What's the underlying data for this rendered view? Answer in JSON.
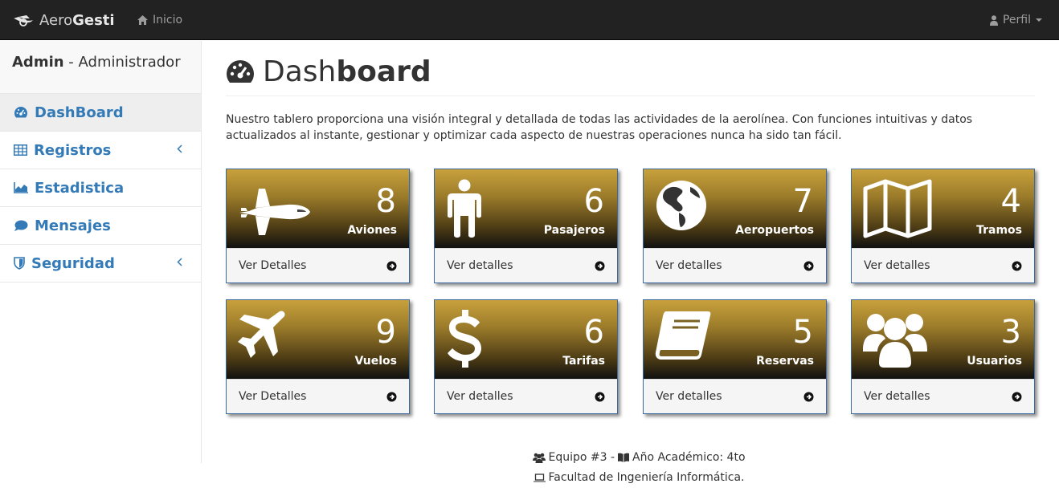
{
  "navbar": {
    "brand_prefix": "Aero",
    "brand_suffix": "Gesti",
    "home_label": "Inicio",
    "profile_label": "Perfil"
  },
  "sidebar": {
    "user_role_name": "Admin",
    "user_separator": " - ",
    "user_role_title": "Administrador",
    "items": [
      {
        "label": "DashBoard",
        "icon": "dashboard-icon",
        "active": true
      },
      {
        "label": "Registros",
        "icon": "table-icon",
        "has_submenu": true
      },
      {
        "label": "Estadistica",
        "icon": "area-chart-icon"
      },
      {
        "label": "Mensajes",
        "icon": "comment-icon"
      },
      {
        "label": "Seguridad",
        "icon": "shield-icon",
        "has_submenu": true
      }
    ]
  },
  "page": {
    "title_light": "Dash",
    "title_bold": "board",
    "intro_line1": "Nuestro tablero proporciona una visión integral y detallada de todas las actividades de la aerolínea. Con funciones intuitivas y datos",
    "intro_line2": "actualizados al instante, gestionar y optimizar cada aspecto de nuestras operaciones nunca ha sido tan fácil."
  },
  "cards": [
    {
      "count": "8",
      "label": "Aviones",
      "link": "Ver Detalles",
      "icon": "space-shuttle-icon"
    },
    {
      "count": "6",
      "label": "Pasajeros",
      "link": "Ver detalles",
      "icon": "male-icon"
    },
    {
      "count": "7",
      "label": "Aeropuertos",
      "link": "Ver detalles",
      "icon": "globe-icon"
    },
    {
      "count": "4",
      "label": "Tramos",
      "link": "Ver detalles",
      "icon": "map-icon"
    },
    {
      "count": "9",
      "label": "Vuelos",
      "link": "Ver Detalles",
      "icon": "plane-icon"
    },
    {
      "count": "6",
      "label": "Tarifas",
      "link": "Ver detalles",
      "icon": "dollar-icon"
    },
    {
      "count": "5",
      "label": "Reservas",
      "link": "Ver detalles",
      "icon": "book-icon"
    },
    {
      "count": "3",
      "label": "Usuarios",
      "link": "Ver detalles",
      "icon": "users-icon"
    }
  ],
  "footer": {
    "team": "Equipo #3 -",
    "year": "Año Académico: 4to",
    "faculty": "Facultad de Ingeniería Informática."
  },
  "colors": {
    "navbar_bg": "#222222",
    "link_blue": "#337ab7",
    "card_gold": "#c8a13c",
    "card_border": "#3a6aa0"
  }
}
